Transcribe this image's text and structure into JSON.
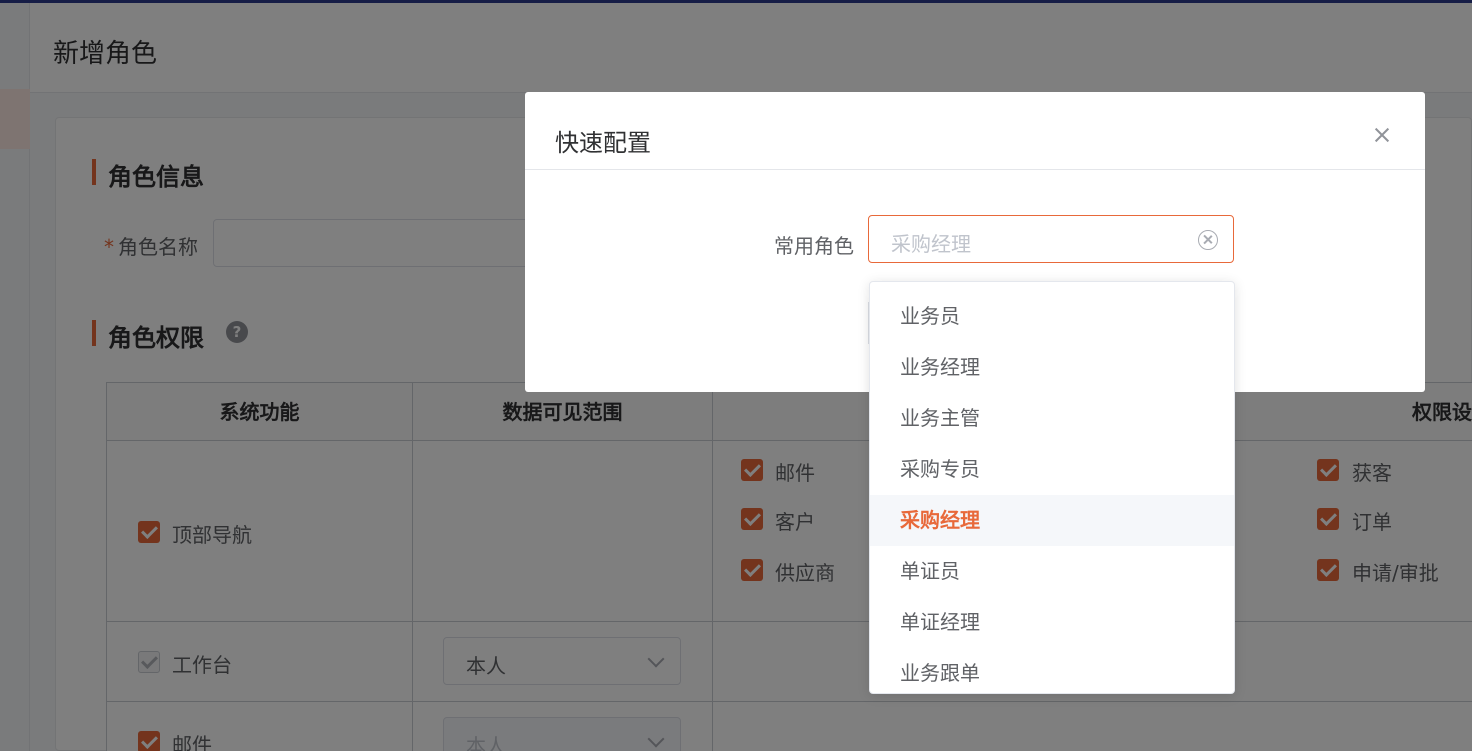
{
  "page": {
    "title": "新增角色"
  },
  "role_info": {
    "section_title": "角色信息",
    "name_label": "角色名称",
    "required_mark": "*"
  },
  "role_permissions": {
    "section_title": "角色权限",
    "help_icon": "?",
    "headers": [
      "系统功能",
      "数据可见范围",
      "",
      "权限设置"
    ],
    "rows": [
      {
        "function": "顶部导航",
        "checked": true,
        "scope": "",
        "permissions_col1": [
          "邮件",
          "客户",
          "供应商"
        ],
        "permissions_col2": [
          "获客",
          "订单",
          "申请/审批"
        ]
      },
      {
        "function": "工作台",
        "checked": true,
        "disabled": true,
        "scope": "本人"
      },
      {
        "function": "邮件",
        "checked": true,
        "scope": "本人",
        "scope_disabled": true
      }
    ]
  },
  "dialog": {
    "title": "快速配置",
    "close_icon": "close-icon",
    "form_label": "常用角色",
    "select_placeholder": "采购经理",
    "clear_icon": "circle-close-icon"
  },
  "dropdown": {
    "options": [
      "业务员",
      "业务经理",
      "业务主管",
      "采购专员",
      "采购经理",
      "单证员",
      "单证经理",
      "业务跟单"
    ],
    "selected": "采购经理"
  },
  "colors": {
    "accent": "#e8693a",
    "mask": "rgba(0,0,0,0.5)"
  }
}
